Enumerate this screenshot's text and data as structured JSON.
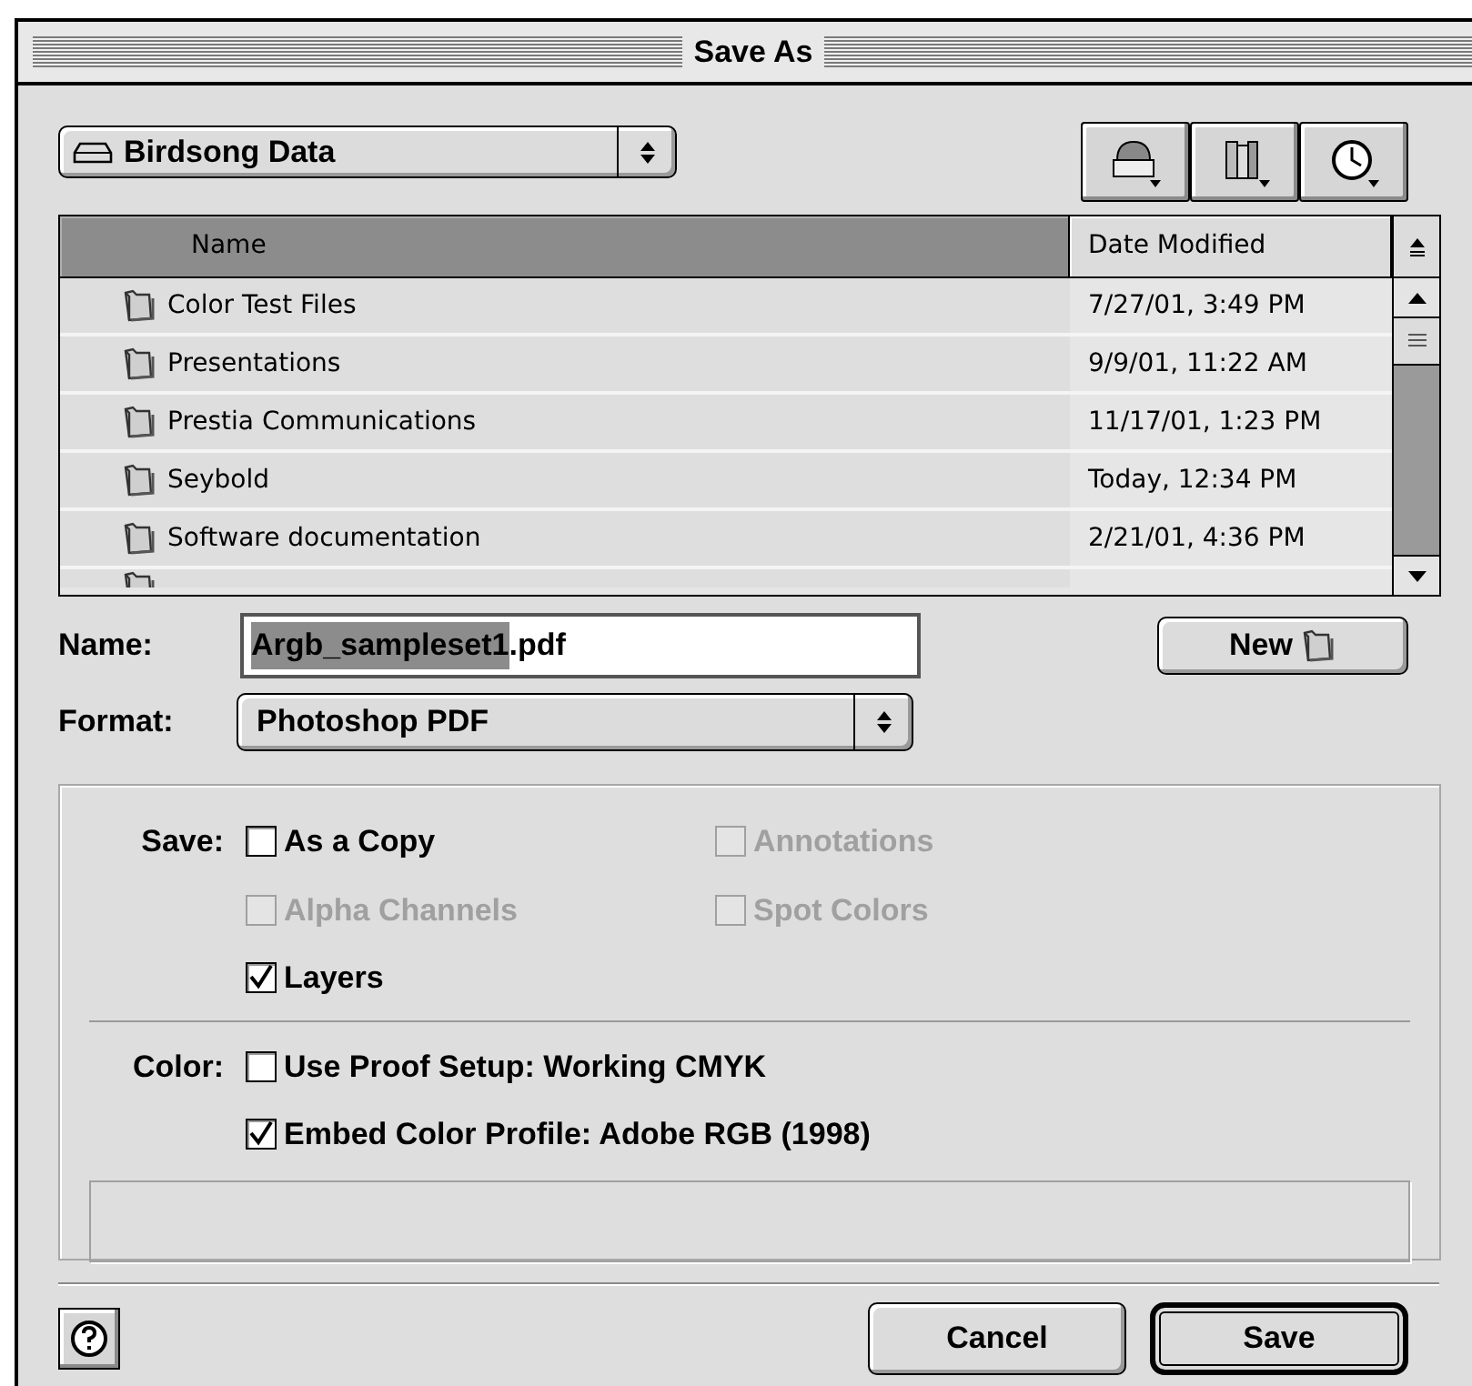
{
  "window": {
    "title": "Save As"
  },
  "location": {
    "label": "Birdsong Data"
  },
  "columns": [
    {
      "label": "Name",
      "selected": true
    },
    {
      "label": "Date Modified",
      "selected": false
    }
  ],
  "rows": [
    {
      "name": "Color Test Files",
      "date": "7/27/01, 3:49 PM"
    },
    {
      "name": "Presentations",
      "date": "9/9/01, 11:22 AM"
    },
    {
      "name": "Prestia Communications",
      "date": "11/17/01, 1:23 PM"
    },
    {
      "name": "Seybold",
      "date": "Today, 12:34 PM"
    },
    {
      "name": "Software documentation",
      "date": "2/21/01, 4:36 PM"
    }
  ],
  "name_field": {
    "label": "Name:",
    "selected_text": "Argb_sampleset1",
    "rest_text": ".pdf"
  },
  "new_button": {
    "label": "New"
  },
  "format": {
    "label": "Format:",
    "value": "Photoshop PDF"
  },
  "option_groups": [
    {
      "label": "Save:",
      "items": [
        {
          "label": "As a Copy",
          "checked": false,
          "disabled": false
        },
        {
          "label": "Annotations",
          "checked": false,
          "disabled": true
        },
        {
          "label": "Alpha Channels",
          "checked": false,
          "disabled": true
        },
        {
          "label": "Spot Colors",
          "checked": false,
          "disabled": true
        },
        {
          "label": "Layers",
          "checked": true,
          "disabled": false
        }
      ],
      "kind": "grid"
    },
    {
      "label": "Color:",
      "items": [
        {
          "label": "Use Proof Setup: Working CMYK",
          "checked": false,
          "disabled": false
        },
        {
          "label": "Embed Color Profile: Adobe RGB (1998)",
          "checked": true,
          "disabled": false
        }
      ],
      "kind": "list"
    }
  ],
  "buttons": [
    {
      "label": "Cancel",
      "default": false
    },
    {
      "label": "Save",
      "default": true
    }
  ]
}
